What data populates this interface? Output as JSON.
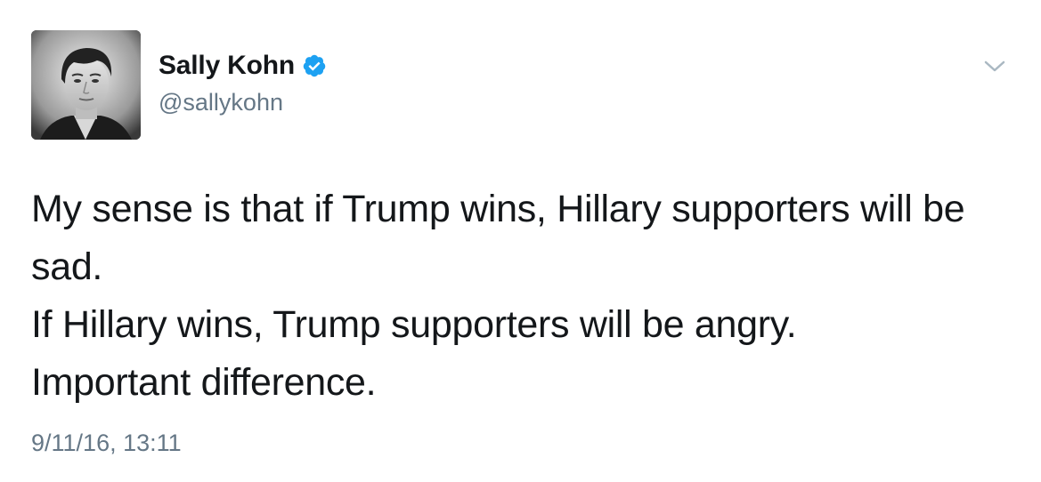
{
  "tweet": {
    "author": {
      "display_name": "Sally Kohn",
      "handle": "@sallykohn",
      "verified": true
    },
    "text_lines": [
      "My sense is that if Trump wins, Hillary supporters will be",
      "sad.",
      "If Hillary wins, Trump supporters will be angry.",
      "Important difference."
    ],
    "timestamp": "9/11/16, 13:11"
  },
  "colors": {
    "verified_badge": "#1da1f2",
    "secondary_text": "#657786",
    "primary_text": "#14171a"
  },
  "icons": {
    "verified": "verified-badge-icon",
    "menu": "chevron-down-icon"
  }
}
